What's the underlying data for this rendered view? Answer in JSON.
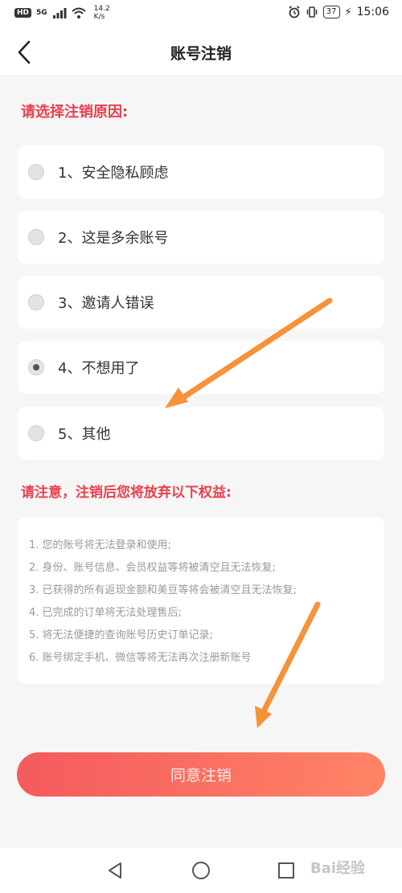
{
  "status_bar": {
    "hd": "HD",
    "signal": "5G",
    "net_speed_value": "14.2",
    "net_speed_unit": "K/s",
    "battery": "37",
    "time": "15:06"
  },
  "header": {
    "title": "账号注销"
  },
  "reasons": {
    "title": "请选择注销原因:",
    "items": [
      {
        "label": "1、安全隐私顾虑",
        "checked": false
      },
      {
        "label": "2、这是多余账号",
        "checked": false
      },
      {
        "label": "3、邀请人错误",
        "checked": false
      },
      {
        "label": "4、不想用了",
        "checked": true
      },
      {
        "label": "5、其他",
        "checked": false
      }
    ]
  },
  "notice": {
    "title": "请注意，注销后您将放弃以下权益:",
    "items": [
      "1. 您的账号将无法登录和使用;",
      "2. 身份、账号信息、会员权益等将被清空且无法恢复;",
      "3. 已获得的所有返现金额和美豆等将会被清空且无法恢复;",
      "4. 已完成的订单将无法处理售后;",
      "5. 将无法便捷的查询账号历史订单记录;",
      "6. 账号绑定手机、微信等将无法再次注册新账号"
    ]
  },
  "agree_button": "同意注销",
  "watermark": "Bai经验",
  "colors": {
    "accent": "#ea3f4d",
    "button_start": "#f45a5e",
    "button_end": "#ff8466",
    "annotation_arrow": "#f5923a"
  }
}
